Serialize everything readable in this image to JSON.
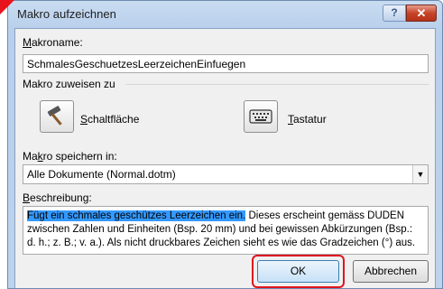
{
  "window": {
    "title": "Makro aufzeichnen",
    "help_label": "?",
    "close_label": "✕"
  },
  "macro_name": {
    "label_prefix": "M",
    "label_rest": "akroname:",
    "value": "SchmalesGeschuetzesLeerzeichenEinfuegen"
  },
  "assign": {
    "label": "Makro zuweisen zu",
    "button_label_prefix": "S",
    "button_label_rest": "chaltfläche",
    "button_icon": "hammer-icon",
    "keyboard_label_prefix": "T",
    "keyboard_label_rest": "astatur",
    "keyboard_icon": "keyboard-icon"
  },
  "store": {
    "label_a": "Ma",
    "label_underline": "k",
    "label_b": "ro speichern in:",
    "value": "Alle Dokumente (Normal.dotm)"
  },
  "description": {
    "label_prefix": "B",
    "label_rest": "eschreibung:",
    "highlighted": "Fügt ein schmales geschützes Leerzeichen ein.",
    "line1_rest": " Dieses erscheint gemäss DUDEN",
    "line2": "zwischen Zahlen und Einheiten (Bsp. 20 mm) und bei gewissen Abkürzungen (Bsp.:",
    "line3": "d. h.; z. B.; v. a.). Als nicht druckbares Zeichen sieht es wie das Gradzeichen (°) aus."
  },
  "buttons": {
    "ok": "OK",
    "cancel": "Abbrechen"
  },
  "colors": {
    "highlight": "#3399ff",
    "annotation": "#e0141e",
    "close": "#c64529"
  }
}
